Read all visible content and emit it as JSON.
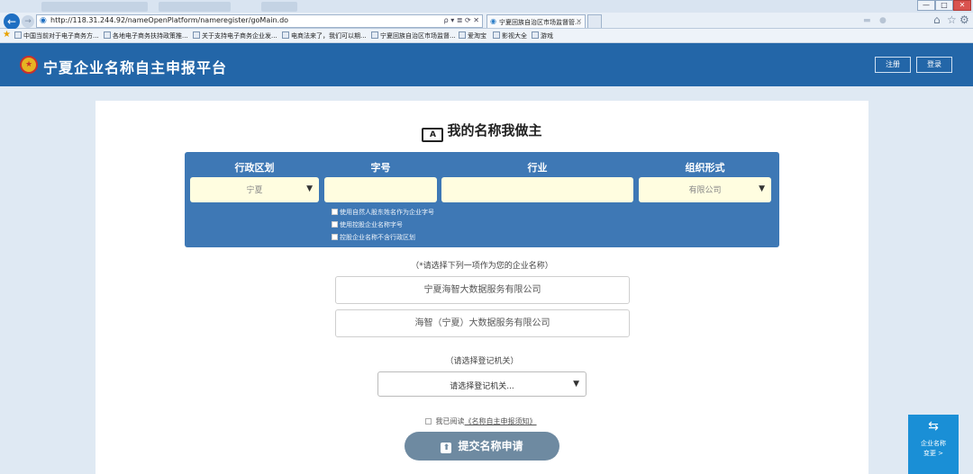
{
  "browser": {
    "address_url": "http://118.31.244.92/nameOpenPlatform/nameregister/goMain.do",
    "address_tools": "ρ ▾ ≣ ⟳ ✕",
    "active_tab_label": "宁夏回族自治区市场监督管...",
    "tab_close": "×",
    "favorites": [
      "中国当前对于电子商务方...",
      "各地电子商务扶持政策推...",
      "关于支持电子商务企业发...",
      "电商法来了，我们可以期...",
      "宁夏回族自治区市场监督...",
      "爱淘宝",
      "影视大全",
      "游戏"
    ]
  },
  "header": {
    "title": "宁夏企业名称自主申报平台",
    "register_label": "注册",
    "login_label": "登录"
  },
  "form": {
    "slogan": "我的名称我做主",
    "columns": {
      "region": "行政区划",
      "name": "字号",
      "industry": "行业",
      "org_form": "组织形式"
    },
    "region_value": "宁夏",
    "org_form_value": "有限公司",
    "name_value": "",
    "industry_value": "",
    "checkboxes": [
      "使用自然人股东姓名作为企业字号",
      "使用控股企业名称字号",
      "控股企业名称不含行政区划"
    ]
  },
  "choose_prompt": "（*请选择下列一项作为您的企业名称）",
  "name_options": [
    "宁夏海智大数据服务有限公司",
    "海智（宁夏）大数据服务有限公司"
  ],
  "registration": {
    "prompt": "（请选择登记机关）",
    "placeholder": "请选择登记机关..."
  },
  "agreement": {
    "prefix": "我已阅读",
    "link": "《名称自主申报须知》"
  },
  "submit_label": "提交名称申请",
  "side_widget": {
    "line1": "企业名称",
    "line2": "变更 >"
  },
  "colors": {
    "header_bg": "#2366a8",
    "panel_bg": "#3e78b5",
    "field_bg": "#fffde0",
    "submit_bg": "#6e8aa1",
    "side_widget_bg": "#1a8fd6"
  }
}
